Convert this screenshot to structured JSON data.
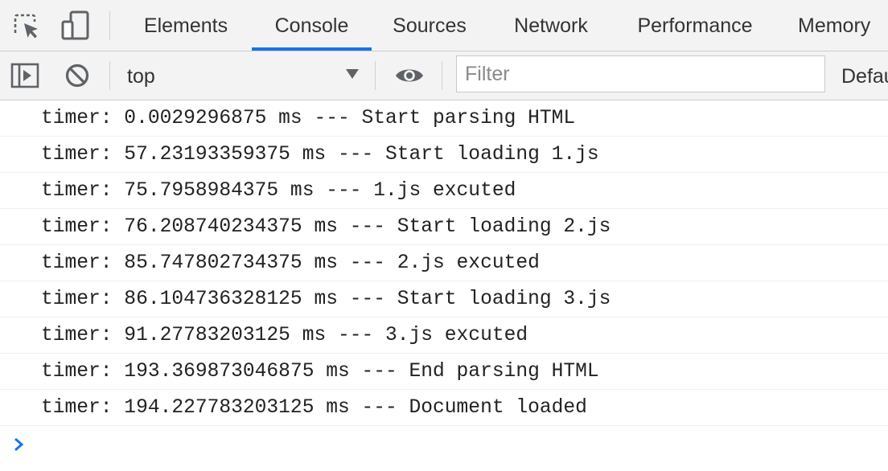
{
  "tabbar": {
    "tabs": [
      {
        "label": "Elements"
      },
      {
        "label": "Console"
      },
      {
        "label": "Sources"
      },
      {
        "label": "Network"
      },
      {
        "label": "Performance"
      },
      {
        "label": "Memory"
      }
    ],
    "active_tab": "Console",
    "accent_color": "#1a73e8"
  },
  "toolbar": {
    "context": "top",
    "filter_placeholder": "Filter",
    "filter_value": "",
    "levels_label": "Defau"
  },
  "console": {
    "messages": [
      "timer: 0.0029296875 ms --- Start parsing HTML",
      "timer: 57.23193359375 ms --- Start loading 1.js",
      "timer: 75.7958984375 ms --- 1.js excuted",
      "timer: 76.208740234375 ms --- Start loading 2.js",
      "timer: 85.747802734375 ms --- 2.js excuted",
      "timer: 86.104736328125 ms --- Start loading 3.js",
      "timer: 91.27783203125 ms --- 3.js excuted",
      "timer: 193.369873046875 ms --- End parsing HTML",
      "timer: 194.227783203125 ms --- Document loaded"
    ],
    "prompt_color": "#1a73e8"
  },
  "icons": {
    "inspect": "inspect-element-icon",
    "device": "device-toolbar-icon",
    "sidebar": "show-sidebar-icon",
    "clear": "clear-console-icon",
    "dropdown": "dropdown-arrow-icon",
    "eye": "live-expression-icon",
    "prompt": "prompt-chevron-icon"
  }
}
